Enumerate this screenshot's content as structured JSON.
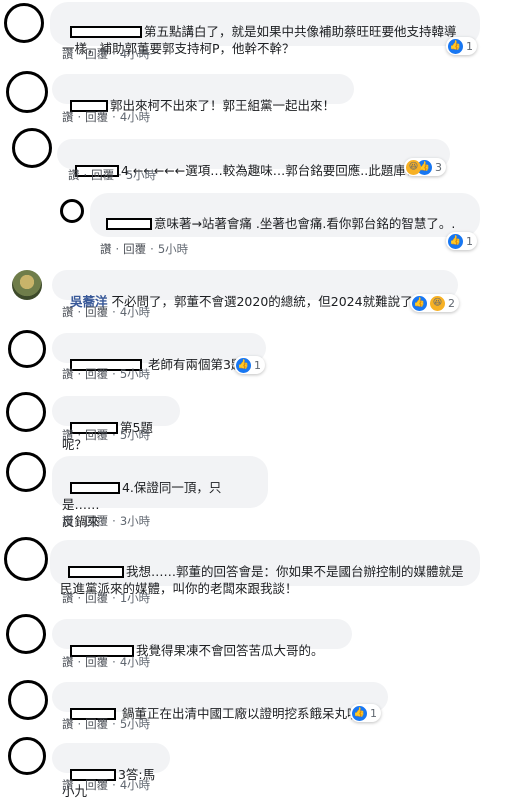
{
  "labels": {
    "like": "讚",
    "dot": "·",
    "reply": "回覆"
  },
  "comments": [
    {
      "text": "第五點講白了，就是如果中共像補助蔡旺旺要他支持韓導一樣，補助郭董要郭支持柯P，他幹不幹？",
      "time": "4小時",
      "reactions": "1"
    },
    {
      "text": "郭出來柯不出來了！郭王組黨一起出來！",
      "time": "4小時"
    },
    {
      "text": "4.←←←←←選項…較為趣味…郭台銘要回應..此題庫？？",
      "time": "5小時",
      "reactions": "3"
    },
    {
      "text": "意味著→站著會痛 .坐著也會痛.看你郭台銘的智慧了。.",
      "time": "5小時",
      "reactions": "1"
    },
    {
      "author": "吳蕎洋",
      "text": "不必問了，郭董不會選2020的總統，但2024就難說了。",
      "time": "4小時",
      "reactions": "2"
    },
    {
      "text": "老師有兩個第3題喔",
      "time": "5小時",
      "reactions": "1"
    },
    {
      "text": "第5題呢？",
      "time": "5小時"
    },
    {
      "text": "4.保證同一頂，只是……\n反鍋來",
      "time": "3小時"
    },
    {
      "text": "我想……郭董的回答會是：你如果不是國台辦控制的媒體就是民進黨派來的媒體，叫你的老闆來跟我談！",
      "time": "1小時"
    },
    {
      "text": "我覺得果凍不會回答苦瓜大哥的。",
      "time": "4小時"
    },
    {
      "text": "鍋董正在出清中國工廠以證明挖系餓呆丸啦",
      "time": "5小時",
      "reactions": "1"
    },
    {
      "text": "3答:馬小九",
      "time": "4小時"
    }
  ]
}
